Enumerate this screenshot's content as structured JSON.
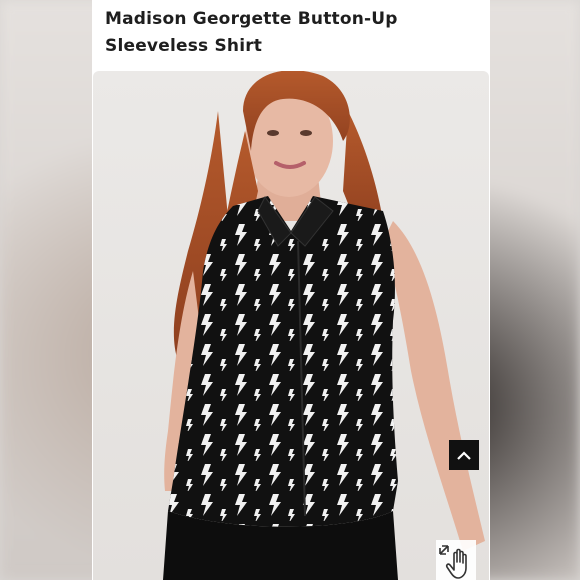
{
  "product": {
    "title": "Madison Georgette Button-Up Sleeveless Shirt"
  },
  "photo": {
    "alt": "Model wearing black sleeveless button-up shirt with white lightning bolt print"
  },
  "controls": {
    "scroll_top_icon": "chevron-up-icon",
    "zoom_icon": "hand-pointer-expand-icon"
  },
  "colors": {
    "shirt": "#111111",
    "print": "#f2f2f2",
    "hair": "#a8502a",
    "skin": "#e7b9a4",
    "backdrop": "#e6e3e0"
  }
}
